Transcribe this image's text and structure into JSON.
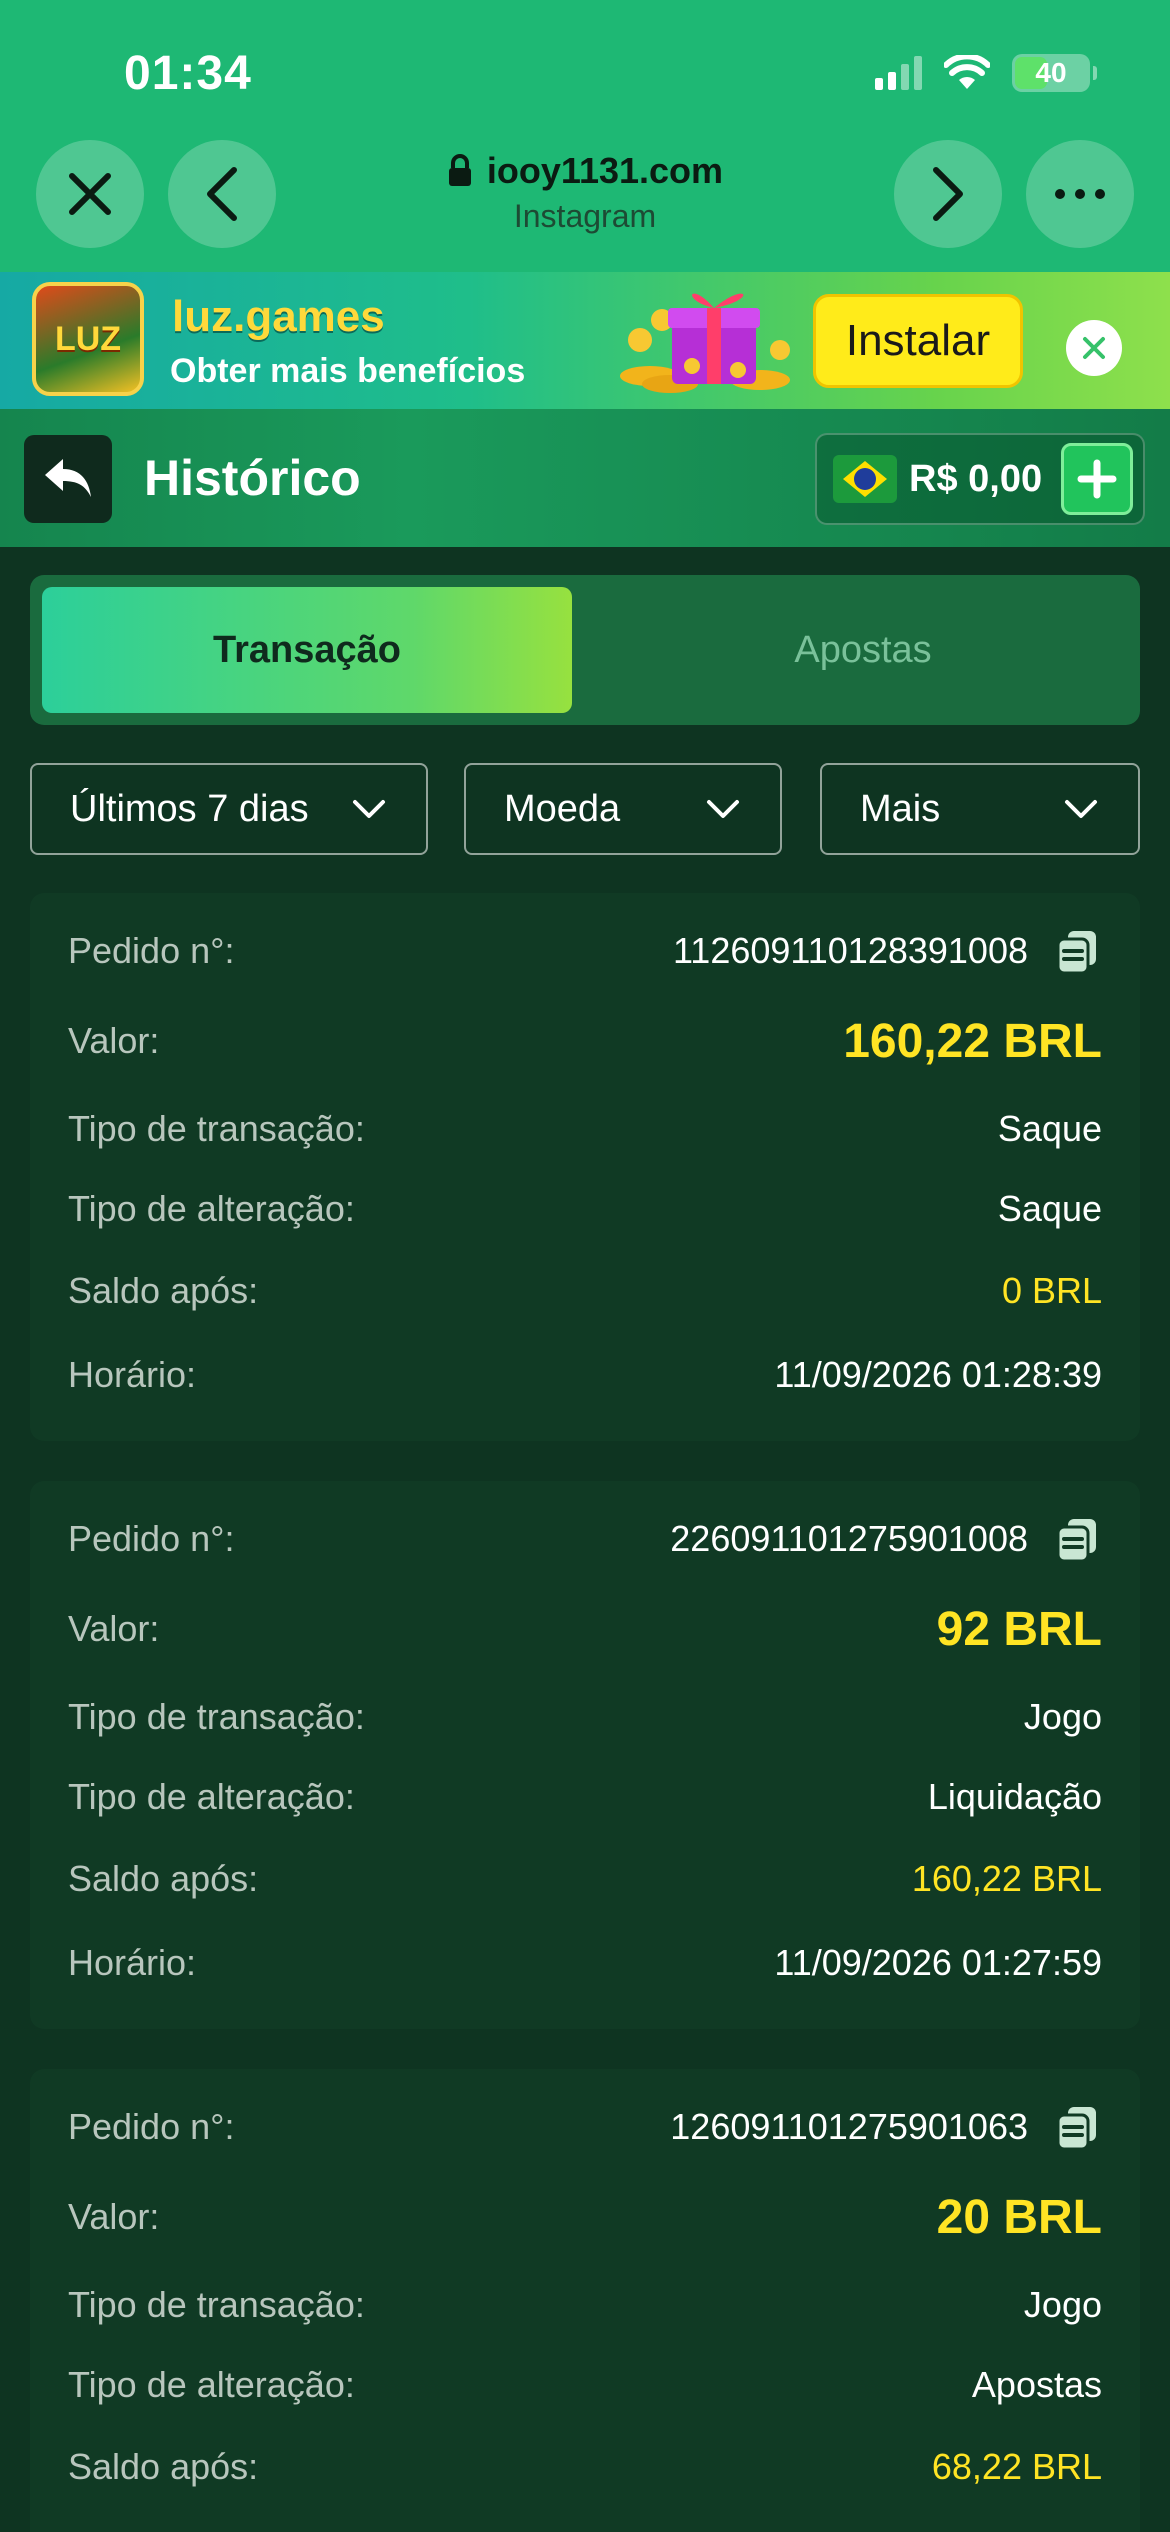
{
  "status_bar": {
    "time": "01:34",
    "battery": "40"
  },
  "browser": {
    "url": "iooy1131.com",
    "source": "Instagram"
  },
  "banner": {
    "app_name": "luz.games",
    "logo_text": "LUZ",
    "tagline": "Obter mais benefícios",
    "install_label": "Instalar"
  },
  "header": {
    "title": "Histórico",
    "balance": "R$ 0,00"
  },
  "tabs": [
    {
      "label": "Transação"
    },
    {
      "label": "Apostas"
    }
  ],
  "filters": [
    {
      "label": "Últimos 7 dias"
    },
    {
      "label": "Moeda"
    },
    {
      "label": "Mais"
    }
  ],
  "labels": {
    "order": "Pedido n°:",
    "value": "Valor:",
    "transaction_type": "Tipo de transação:",
    "change_type": "Tipo de alteração:",
    "balance_after": "Saldo após:",
    "time": "Horário:"
  },
  "transactions": [
    {
      "order": "112609110128391008",
      "value": "160,22 BRL",
      "transaction_type": "Saque",
      "change_type": "Saque",
      "balance_after": "0 BRL",
      "time": "11/09/2026 01:28:39"
    },
    {
      "order": "226091101275901008",
      "value": "92 BRL",
      "transaction_type": "Jogo",
      "change_type": "Liquidação",
      "balance_after": "160,22 BRL",
      "time": "11/09/2026 01:27:59"
    },
    {
      "order": "126091101275901063",
      "value": "20 BRL",
      "transaction_type": "Jogo",
      "change_type": "Apostas",
      "balance_after": "68,22 BRL"
    }
  ],
  "colors": {
    "accent_yellow": "#ffe424",
    "brand_green": "#1eb874",
    "card_bg": "#103a24"
  }
}
